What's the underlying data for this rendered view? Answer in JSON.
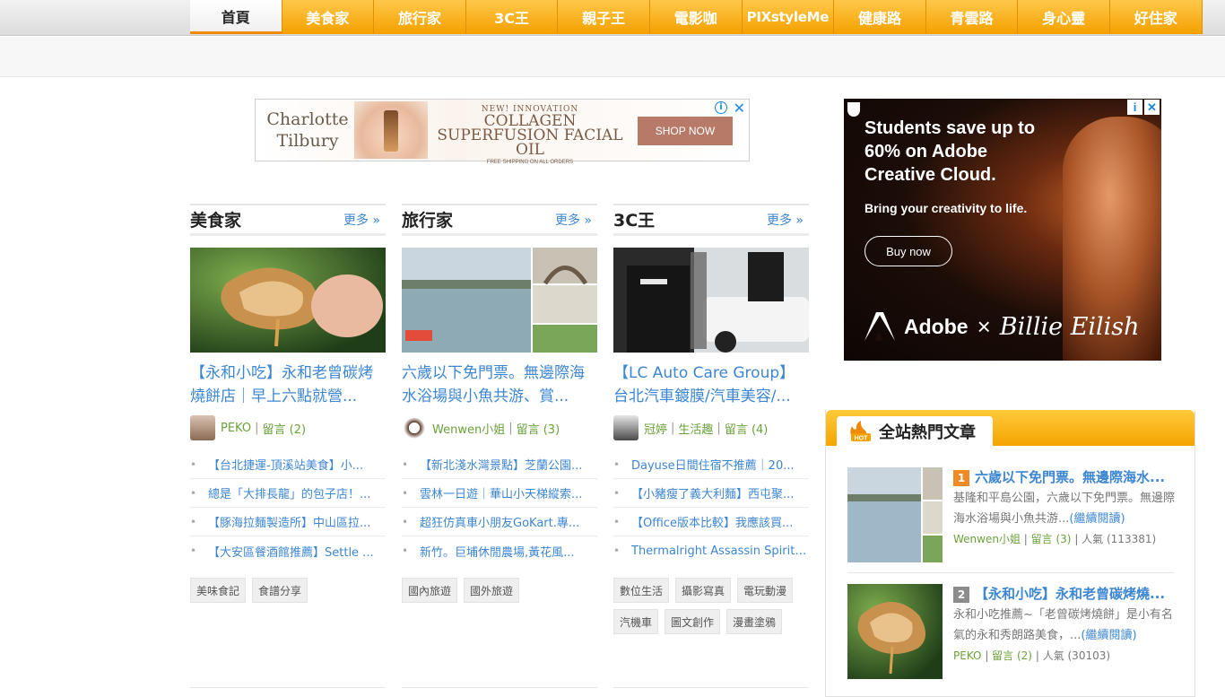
{
  "nav": {
    "items": [
      "首頁",
      "美食家",
      "旅行家",
      "3C王",
      "親子王",
      "電影咖",
      "PIXstyleMe",
      "健康路",
      "青雲路",
      "身心靈",
      "好住家"
    ],
    "active_index": 0
  },
  "ad_left": {
    "brand": "Charlotte Tilbury",
    "kicker": "NEW! INNOVATION",
    "headline": "COLLAGEN SUPERFUSION FACIAL OIL",
    "fine": "FREE SHIPPING ON ALL ORDERS",
    "button": "SHOP NOW",
    "info_icon": "info-icon",
    "close_icon": "close-icon"
  },
  "ad_right": {
    "headline": "Students save up to 60% on Adobe Creative Cloud.",
    "sub": "Bring your creativity to life.",
    "button": "Buy now",
    "brand": "Adobe",
    "times": "×",
    "artist": "Billie Eilish",
    "colors": {
      "background": "#1c0d08",
      "accent": "#c76428"
    }
  },
  "columns": [
    {
      "title": "美食家",
      "more": "更多 »",
      "headline": "【永和小吃】永和老曾碳烤燒餅店｜早上六點就營...",
      "author": "PEKO",
      "comments": "留言 (2)",
      "list": [
        "【台北捷運-頂溪站美食】小...",
        "總是「大排長龍」的包子店！...",
        "【豚海拉麵製造所】中山區拉...",
        "【大安區餐酒館推薦】Settle ..."
      ],
      "tags": [
        "美味食記",
        "食譜分享"
      ]
    },
    {
      "title": "旅行家",
      "more": "更多 »",
      "headline": "六歲以下免門票。無邊際海水浴場與小魚共游、賞...",
      "author": "Wenwen小姐",
      "comments": "留言 (3)",
      "list": [
        "【新北淺水灣景點】芝蘭公園...",
        "雲林一日遊｜華山小天梯縱索...",
        "超狂仿真車小朋友GoKart.專...",
        "新竹。巨埔休閒農場,黃花風..."
      ],
      "tags": [
        "國內旅遊",
        "國外旅遊"
      ]
    },
    {
      "title": "3C王",
      "more": "更多 »",
      "headline": "【LC Auto Care Group】台北汽車鍍膜/汽車美容/...",
      "author": "冠婷",
      "category": "生活趣",
      "comments": "留言 (4)",
      "list": [
        "Dayuse日間住宿不推薦｜20...",
        "【小豬瘦了義大利麵】西屯聚...",
        "【Office版本比較】我應該買...",
        "Thermalright Assassin Spirit ..."
      ],
      "tags": [
        "數位生活",
        "攝影寫真",
        "電玩動漫",
        "汽機車",
        "圖文創作",
        "漫畫塗鴉"
      ]
    }
  ],
  "hot": {
    "title": "全站熱門文章",
    "badge": "HOT",
    "items": [
      {
        "rank": "1",
        "rank_color": "#f08a24",
        "title": "六歲以下免門票。無邊際海水...",
        "desc": "基隆和平島公園，六歲以下免門票。無邊際海水浴場與小魚共游...",
        "read_more": "(繼續閱讀)",
        "author": "Wenwen小姐",
        "comments": "留言 (3)",
        "views": "人氣 (113381)"
      },
      {
        "rank": "2",
        "rank_color": "#8c8c8c",
        "title": "【永和小吃】永和老曾碳烤燒...",
        "desc": "永和小吃推薦~「老曾碳烤燒餅」是小有名氣的永和秀朗路美食，...",
        "read_more": "(繼續閱讀)",
        "author": "PEKO",
        "comments": "留言 (2)",
        "views": "人氣 (30103)"
      }
    ]
  }
}
